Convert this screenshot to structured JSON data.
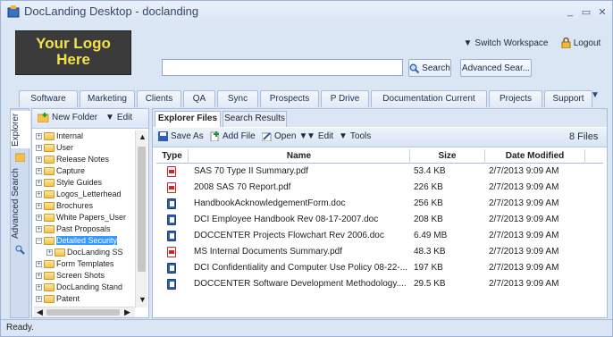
{
  "window": {
    "title": "DocLanding Desktop - doclanding",
    "minimize": "_",
    "maximize": "▭",
    "close": "✕"
  },
  "header": {
    "logo_line1": "Your Logo",
    "logo_line2": "Here",
    "switch_workspace": "Switch Workspace",
    "logout": "Logout",
    "search_placeholder": "",
    "search_button": "Search",
    "advanced_search": "Advanced Sear..."
  },
  "tabs": [
    "Software",
    "Marketing",
    "Clients",
    "QA",
    "Sync",
    "Prospects",
    "P Drive",
    "Documentation Current",
    "Projects",
    "Support"
  ],
  "left_rail": {
    "explorer": "Explorer",
    "advanced_search": "Advanced Search"
  },
  "tree_toolbar": {
    "new_folder": "New Folder",
    "edit": "Edit"
  },
  "tree": [
    {
      "label": "Internal",
      "indent": 0,
      "selected": false
    },
    {
      "label": "User",
      "indent": 0,
      "selected": false
    },
    {
      "label": "Release Notes",
      "indent": 0,
      "selected": false
    },
    {
      "label": "Capture",
      "indent": 0,
      "selected": false
    },
    {
      "label": "Style Guides",
      "indent": 0,
      "selected": false
    },
    {
      "label": "Logos_Letterhead",
      "indent": 0,
      "selected": false
    },
    {
      "label": "Brochures",
      "indent": 0,
      "selected": false
    },
    {
      "label": "White Papers_User",
      "indent": 0,
      "selected": false
    },
    {
      "label": "Past Proposals",
      "indent": 0,
      "selected": false
    },
    {
      "label": "Detailed Security",
      "indent": 0,
      "selected": true
    },
    {
      "label": "DocLanding SS",
      "indent": 1,
      "selected": false
    },
    {
      "label": "Form Templates",
      "indent": 0,
      "selected": false
    },
    {
      "label": "Screen Shots",
      "indent": 0,
      "selected": false
    },
    {
      "label": "DocLanding Stand",
      "indent": 0,
      "selected": false
    },
    {
      "label": "Patent",
      "indent": 0,
      "selected": false
    }
  ],
  "subtabs": {
    "explorer_files": "Explorer Files",
    "search_results": "Search Results"
  },
  "toolbar": {
    "save_as": "Save As",
    "add_file": "Add File",
    "open": "Open",
    "edit": "Edit",
    "tools": "Tools",
    "count": "8 Files"
  },
  "table": {
    "headers": {
      "type": "Type",
      "name": "Name",
      "size": "Size",
      "date": "Date Modified"
    },
    "rows": [
      {
        "kind": "pdf",
        "name": "SAS 70 Type II Summary.pdf",
        "size": "53.4 KB",
        "date": "2/7/2013 9:09 AM"
      },
      {
        "kind": "pdf",
        "name": "2008 SAS 70 Report.pdf",
        "size": "226 KB",
        "date": "2/7/2013 9:09 AM"
      },
      {
        "kind": "doc",
        "name": "HandbookAcknowledgementForm.doc",
        "size": "256 KB",
        "date": "2/7/2013 9:09 AM"
      },
      {
        "kind": "doc",
        "name": "DCI Employee Handbook Rev 08-17-2007.doc",
        "size": "208 KB",
        "date": "2/7/2013 9:09 AM"
      },
      {
        "kind": "doc",
        "name": "DOCCENTER Projects Flowchart Rev 2006.doc",
        "size": "6.49 MB",
        "date": "2/7/2013 9:09 AM"
      },
      {
        "kind": "pdf",
        "name": "MS Internal Documents Summary.pdf",
        "size": "48.3 KB",
        "date": "2/7/2013 9:09 AM"
      },
      {
        "kind": "doc",
        "name": "DCI Confidentiality and Computer Use Policy 08-22-...",
        "size": "197 KB",
        "date": "2/7/2013 9:09 AM"
      },
      {
        "kind": "doc",
        "name": "DOCCENTER Software Development Methodology....",
        "size": "29.5 KB",
        "date": "2/7/2013 9:09 AM"
      }
    ]
  },
  "status": "Ready."
}
